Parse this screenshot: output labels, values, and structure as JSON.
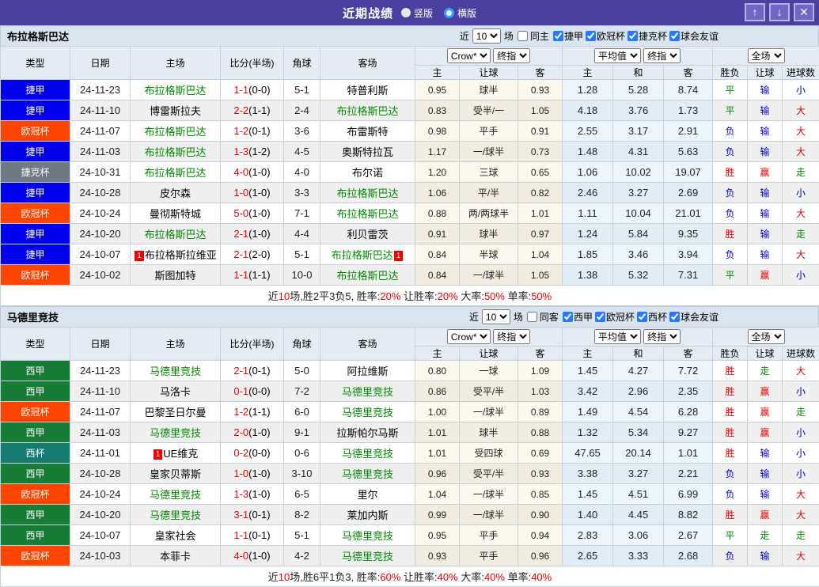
{
  "titlebar": {
    "title": "近期战绩",
    "radios": [
      {
        "label": "竖版",
        "selected": false
      },
      {
        "label": "横版",
        "selected": true
      }
    ],
    "buttons": [
      {
        "name": "move-up-button",
        "glyph": "↑"
      },
      {
        "name": "move-down-button",
        "glyph": "↓"
      },
      {
        "name": "close-button",
        "glyph": "✕"
      }
    ],
    "bg_color": "#4b3fa0"
  },
  "columns": {
    "type": "类型",
    "date": "日期",
    "home": "主场",
    "score": "比分(半场)",
    "corner": "角球",
    "away": "客场",
    "dropdowns": [
      "Crow*",
      "终指",
      "平均值",
      "终指",
      "全场"
    ],
    "sub": [
      "主",
      "让球",
      "客",
      "主",
      "和",
      "客",
      "胜负",
      "让球",
      "进球数"
    ]
  },
  "league_colors": {
    "捷甲": "#0000ee",
    "欧冠杯": "#ff4400",
    "捷克杯": "#6e7b87",
    "西甲": "#167c36",
    "西杯": "#157a72"
  },
  "result_colors": {
    "胜": "red",
    "平": "green",
    "负": "blue",
    "赢": "red",
    "输": "blue",
    "走": "green",
    "大": "red",
    "小": "blue"
  },
  "sections": [
    {
      "team": "布拉格斯巴达",
      "filter": {
        "prefix": "近",
        "rounds": "10",
        "suffix": "场",
        "same_label": "同主",
        "same_checked": false,
        "leagues": [
          {
            "label": "捷甲",
            "checked": true
          },
          {
            "label": "欧冠杯",
            "checked": true
          },
          {
            "label": "捷克杯",
            "checked": true
          },
          {
            "label": "球会友谊",
            "checked": true
          }
        ]
      },
      "rows": [
        {
          "league": "捷甲",
          "date": "24-11-23",
          "home": "布拉格斯巴达",
          "home_green": true,
          "home_badge": "",
          "score": "1-1",
          "half": "(0-0)",
          "corner": "5-1",
          "away": "特普利斯",
          "away_green": false,
          "away_badge": "",
          "odds": [
            "0.95",
            "球半",
            "0.93"
          ],
          "avg": [
            "1.28",
            "5.28",
            "8.74"
          ],
          "results": [
            "平",
            "输",
            "小"
          ]
        },
        {
          "league": "捷甲",
          "date": "24-11-10",
          "home": "博雷斯拉夫",
          "home_green": false,
          "home_badge": "",
          "score": "2-2",
          "half": "(1-1)",
          "corner": "2-4",
          "away": "布拉格斯巴达",
          "away_green": true,
          "away_badge": "",
          "odds": [
            "0.83",
            "受半/一",
            "1.05"
          ],
          "avg": [
            "4.18",
            "3.76",
            "1.73"
          ],
          "results": [
            "平",
            "输",
            "大"
          ]
        },
        {
          "league": "欧冠杯",
          "date": "24-11-07",
          "home": "布拉格斯巴达",
          "home_green": true,
          "home_badge": "",
          "score": "1-2",
          "half": "(0-1)",
          "corner": "3-6",
          "away": "布雷斯特",
          "away_green": false,
          "away_badge": "",
          "odds": [
            "0.98",
            "平手",
            "0.91"
          ],
          "avg": [
            "2.55",
            "3.17",
            "2.91"
          ],
          "results": [
            "负",
            "输",
            "大"
          ]
        },
        {
          "league": "捷甲",
          "date": "24-11-03",
          "home": "布拉格斯巴达",
          "home_green": true,
          "home_badge": "",
          "score": "1-3",
          "half": "(1-2)",
          "corner": "4-5",
          "away": "奥斯特拉瓦",
          "away_green": false,
          "away_badge": "",
          "odds": [
            "1.17",
            "一/球半",
            "0.73"
          ],
          "avg": [
            "1.48",
            "4.31",
            "5.63"
          ],
          "results": [
            "负",
            "输",
            "大"
          ]
        },
        {
          "league": "捷克杯",
          "date": "24-10-31",
          "home": "布拉格斯巴达",
          "home_green": true,
          "home_badge": "",
          "score": "4-0",
          "half": "(1-0)",
          "corner": "4-0",
          "away": "布尔诺",
          "away_green": false,
          "away_badge": "",
          "odds": [
            "1.20",
            "三球",
            "0.65"
          ],
          "avg": [
            "1.06",
            "10.02",
            "19.07"
          ],
          "results": [
            "胜",
            "赢",
            "走"
          ]
        },
        {
          "league": "捷甲",
          "date": "24-10-28",
          "home": "皮尔森",
          "home_green": false,
          "home_badge": "",
          "score": "1-0",
          "half": "(1-0)",
          "corner": "3-3",
          "away": "布拉格斯巴达",
          "away_green": true,
          "away_badge": "",
          "odds": [
            "1.06",
            "平/半",
            "0.82"
          ],
          "avg": [
            "2.46",
            "3.27",
            "2.69"
          ],
          "results": [
            "负",
            "输",
            "小"
          ]
        },
        {
          "league": "欧冠杯",
          "date": "24-10-24",
          "home": "曼彻斯特城",
          "home_green": false,
          "home_badge": "",
          "score": "5-0",
          "half": "(1-0)",
          "corner": "7-1",
          "away": "布拉格斯巴达",
          "away_green": true,
          "away_badge": "",
          "odds": [
            "0.88",
            "两/两球半",
            "1.01"
          ],
          "avg": [
            "1.11",
            "10.04",
            "21.01"
          ],
          "results": [
            "负",
            "输",
            "大"
          ]
        },
        {
          "league": "捷甲",
          "date": "24-10-20",
          "home": "布拉格斯巴达",
          "home_green": true,
          "home_badge": "",
          "score": "2-1",
          "half": "(1-0)",
          "corner": "4-4",
          "away": "利贝雷茨",
          "away_green": false,
          "away_badge": "",
          "odds": [
            "0.91",
            "球半",
            "0.97"
          ],
          "avg": [
            "1.24",
            "5.84",
            "9.35"
          ],
          "results": [
            "胜",
            "输",
            "走"
          ]
        },
        {
          "league": "捷甲",
          "date": "24-10-07",
          "home": "布拉格斯拉维亚",
          "home_green": false,
          "home_badge": "1",
          "score": "2-1",
          "half": "(2-0)",
          "corner": "5-1",
          "away": "布拉格斯巴达",
          "away_green": true,
          "away_badge": "1",
          "odds": [
            "0.84",
            "半球",
            "1.04"
          ],
          "avg": [
            "1.85",
            "3.46",
            "3.94"
          ],
          "results": [
            "负",
            "输",
            "大"
          ]
        },
        {
          "league": "欧冠杯",
          "date": "24-10-02",
          "home": "斯图加特",
          "home_green": false,
          "home_badge": "",
          "score": "1-1",
          "half": "(1-1)",
          "corner": "10-0",
          "away": "布拉格斯巴达",
          "away_green": true,
          "away_badge": "",
          "odds": [
            "0.84",
            "一/球半",
            "1.05"
          ],
          "avg": [
            "1.38",
            "5.32",
            "7.31"
          ],
          "results": [
            "平",
            "赢",
            "小"
          ]
        }
      ],
      "summary": [
        {
          "t": "近",
          "c": "black"
        },
        {
          "t": "10",
          "c": "red"
        },
        {
          "t": "场,胜2平3负5, 胜率:",
          "c": "black"
        },
        {
          "t": "20%",
          "c": "red"
        },
        {
          "t": " 让胜率:",
          "c": "black"
        },
        {
          "t": "20%",
          "c": "red"
        },
        {
          "t": " 大率:",
          "c": "black"
        },
        {
          "t": "50%",
          "c": "red"
        },
        {
          "t": " 单率:",
          "c": "black"
        },
        {
          "t": "50%",
          "c": "red"
        }
      ]
    },
    {
      "team": "马德里竞技",
      "filter": {
        "prefix": "近",
        "rounds": "10",
        "suffix": "场",
        "same_label": "同客",
        "same_checked": false,
        "leagues": [
          {
            "label": "西甲",
            "checked": true
          },
          {
            "label": "欧冠杯",
            "checked": true
          },
          {
            "label": "西杯",
            "checked": true
          },
          {
            "label": "球会友谊",
            "checked": true
          }
        ]
      },
      "rows": [
        {
          "league": "西甲",
          "date": "24-11-23",
          "home": "马德里竞技",
          "home_green": true,
          "home_badge": "",
          "score": "2-1",
          "half": "(0-1)",
          "corner": "5-0",
          "away": "阿拉维斯",
          "away_green": false,
          "away_badge": "",
          "odds": [
            "0.80",
            "一球",
            "1.09"
          ],
          "avg": [
            "1.45",
            "4.27",
            "7.72"
          ],
          "results": [
            "胜",
            "走",
            "大"
          ]
        },
        {
          "league": "西甲",
          "date": "24-11-10",
          "home": "马洛卡",
          "home_green": false,
          "home_badge": "",
          "score": "0-1",
          "half": "(0-0)",
          "corner": "7-2",
          "away": "马德里竞技",
          "away_green": true,
          "away_badge": "",
          "odds": [
            "0.86",
            "受平/半",
            "1.03"
          ],
          "avg": [
            "3.42",
            "2.96",
            "2.35"
          ],
          "results": [
            "胜",
            "赢",
            "小"
          ]
        },
        {
          "league": "欧冠杯",
          "date": "24-11-07",
          "home": "巴黎圣日尔曼",
          "home_green": false,
          "home_badge": "",
          "score": "1-2",
          "half": "(1-1)",
          "corner": "6-0",
          "away": "马德里竞技",
          "away_green": true,
          "away_badge": "",
          "odds": [
            "1.00",
            "一/球半",
            "0.89"
          ],
          "avg": [
            "1.49",
            "4.54",
            "6.28"
          ],
          "results": [
            "胜",
            "赢",
            "走"
          ]
        },
        {
          "league": "西甲",
          "date": "24-11-03",
          "home": "马德里竞技",
          "home_green": true,
          "home_badge": "",
          "score": "2-0",
          "half": "(1-0)",
          "corner": "9-1",
          "away": "拉斯帕尔马斯",
          "away_green": false,
          "away_badge": "",
          "odds": [
            "1.01",
            "球半",
            "0.88"
          ],
          "avg": [
            "1.32",
            "5.34",
            "9.27"
          ],
          "results": [
            "胜",
            "赢",
            "小"
          ]
        },
        {
          "league": "西杯",
          "date": "24-11-01",
          "home": "UE维克",
          "home_green": false,
          "home_badge": "1",
          "score": "0-2",
          "half": "(0-0)",
          "corner": "0-6",
          "away": "马德里竞技",
          "away_green": true,
          "away_badge": "",
          "odds": [
            "1.01",
            "受四球",
            "0.69"
          ],
          "avg": [
            "47.65",
            "20.14",
            "1.01"
          ],
          "results": [
            "胜",
            "输",
            "小"
          ]
        },
        {
          "league": "西甲",
          "date": "24-10-28",
          "home": "皇家贝蒂斯",
          "home_green": false,
          "home_badge": "",
          "score": "1-0",
          "half": "(1-0)",
          "corner": "3-10",
          "away": "马德里竞技",
          "away_green": true,
          "away_badge": "",
          "odds": [
            "0.96",
            "受平/半",
            "0.93"
          ],
          "avg": [
            "3.38",
            "3.27",
            "2.21"
          ],
          "results": [
            "负",
            "输",
            "小"
          ]
        },
        {
          "league": "欧冠杯",
          "date": "24-10-24",
          "home": "马德里竞技",
          "home_green": true,
          "home_badge": "",
          "score": "1-3",
          "half": "(1-0)",
          "corner": "6-5",
          "away": "里尔",
          "away_green": false,
          "away_badge": "",
          "odds": [
            "1.04",
            "一/球半",
            "0.85"
          ],
          "avg": [
            "1.45",
            "4.51",
            "6.99"
          ],
          "results": [
            "负",
            "输",
            "大"
          ]
        },
        {
          "league": "西甲",
          "date": "24-10-20",
          "home": "马德里竞技",
          "home_green": true,
          "home_badge": "",
          "score": "3-1",
          "half": "(0-1)",
          "corner": "8-2",
          "away": "莱加内斯",
          "away_green": false,
          "away_badge": "",
          "odds": [
            "0.99",
            "一/球半",
            "0.90"
          ],
          "avg": [
            "1.40",
            "4.45",
            "8.82"
          ],
          "results": [
            "胜",
            "赢",
            "大"
          ]
        },
        {
          "league": "西甲",
          "date": "24-10-07",
          "home": "皇家社会",
          "home_green": false,
          "home_badge": "",
          "score": "1-1",
          "half": "(0-1)",
          "corner": "5-1",
          "away": "马德里竞技",
          "away_green": true,
          "away_badge": "",
          "odds": [
            "0.95",
            "平手",
            "0.94"
          ],
          "avg": [
            "2.83",
            "3.06",
            "2.67"
          ],
          "results": [
            "平",
            "走",
            "走"
          ]
        },
        {
          "league": "欧冠杯",
          "date": "24-10-03",
          "home": "本菲卡",
          "home_green": false,
          "home_badge": "",
          "score": "4-0",
          "half": "(1-0)",
          "corner": "4-2",
          "away": "马德里竞技",
          "away_green": true,
          "away_badge": "",
          "odds": [
            "0.93",
            "平手",
            "0.96"
          ],
          "avg": [
            "2.65",
            "3.33",
            "2.68"
          ],
          "results": [
            "负",
            "输",
            "大"
          ]
        }
      ],
      "summary": [
        {
          "t": "近",
          "c": "black"
        },
        {
          "t": "10",
          "c": "red"
        },
        {
          "t": "场,胜6平1负3, 胜率:",
          "c": "black"
        },
        {
          "t": "60%",
          "c": "red"
        },
        {
          "t": " 让胜率:",
          "c": "black"
        },
        {
          "t": "40%",
          "c": "red"
        },
        {
          "t": " 大率:",
          "c": "black"
        },
        {
          "t": "40%",
          "c": "red"
        },
        {
          "t": " 单率:",
          "c": "black"
        },
        {
          "t": "40%",
          "c": "red"
        }
      ]
    }
  ]
}
